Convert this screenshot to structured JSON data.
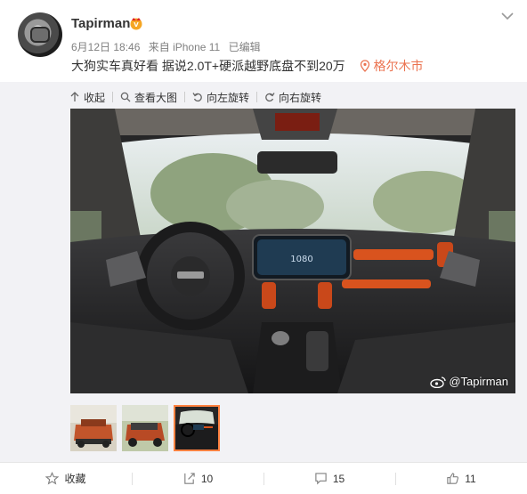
{
  "post": {
    "username": "Tapirman",
    "date": "6月12日 18:46",
    "source": "来自 iPhone 11",
    "edited": "已编辑",
    "text": "大狗实车真好看 据说2.0T+硬派越野底盘不到20万",
    "location": "格尔木市"
  },
  "toolbar": {
    "collapse": "收起",
    "view_large": "查看大图",
    "rotate_left": "向左旋转",
    "rotate_right": "向右旋转"
  },
  "photo": {
    "watermark": "@Tapirman",
    "screen_text": "1080"
  },
  "actions": {
    "favorite": "收藏",
    "repost": "10",
    "comment": "15",
    "like": "11"
  },
  "colors": {
    "accent": "#eb7350",
    "thumb_active": "#ff8140",
    "link": "#eb7350"
  }
}
